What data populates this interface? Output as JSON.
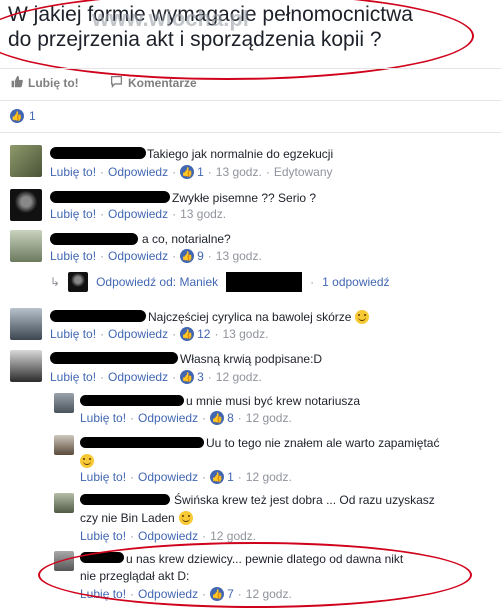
{
  "post": {
    "text_line1": "W jakiej formie wymagacie pełnomocnictwa",
    "text_line2": "do przejrzenia akt i sporządzenia kopii ?",
    "watermark": "www.wiocha.pl"
  },
  "actions": {
    "like_label": "Lubię to!",
    "comment_label": "Komentarze"
  },
  "reactions": {
    "count": "1"
  },
  "comments": [
    {
      "text": "Takiego jak normalnie do egzekucji",
      "like": "Lubię to!",
      "reply": "Odpowiedz",
      "likes": "1",
      "time": "13 godz.",
      "extra": "Edytowany"
    },
    {
      "text": "Zwykłe pisemne ?? Serio ?",
      "like": "Lubię to!",
      "reply": "Odpowiedz",
      "time": "13 godz."
    },
    {
      "text": "a co, notarialne?",
      "like": "Lubię to!",
      "reply": "Odpowiedz",
      "likes": "9",
      "time": "13 godz."
    },
    {
      "text": "Najczęściej cyrylica na bawolej skórze",
      "like": "Lubię to!",
      "reply": "Odpowiedz",
      "likes": "12",
      "time": "13 godz."
    },
    {
      "text": "Własną krwią podpisane:D",
      "like": "Lubię to!",
      "reply": "Odpowiedz",
      "likes": "3",
      "time": "12 godz."
    }
  ],
  "reply_summary": {
    "label": "Odpowiedź od: Maniek",
    "count": "1 odpowiedź"
  },
  "replies": [
    {
      "text": "u mnie musi być krew notariusza",
      "like": "Lubię to!",
      "reply": "Odpowiedz",
      "likes": "8",
      "time": "12 godz."
    },
    {
      "text": "Uu to tego nie znałem ale warto zapamiętać",
      "like": "Lubię to!",
      "reply": "Odpowiedz",
      "likes": "1",
      "time": "12 godz."
    },
    {
      "text_line1": "Świńska krew też jest dobra ... Od razu uzyskasz",
      "text_line2": "czy nie Bin Laden",
      "like": "Lubię to!",
      "reply": "Odpowiedz",
      "time": "12 godz."
    },
    {
      "text_line1": "u nas krew dziewicy... pewnie dlatego od dawna nikt",
      "text_line2": "nie przeglądał akt D:",
      "like": "Lubię to!",
      "reply": "Odpowiedz",
      "likes": "7",
      "time": "12 godz."
    }
  ],
  "colors": {
    "link": "#4267b2",
    "meta": "#90949c",
    "annotation": "#d0021b"
  }
}
